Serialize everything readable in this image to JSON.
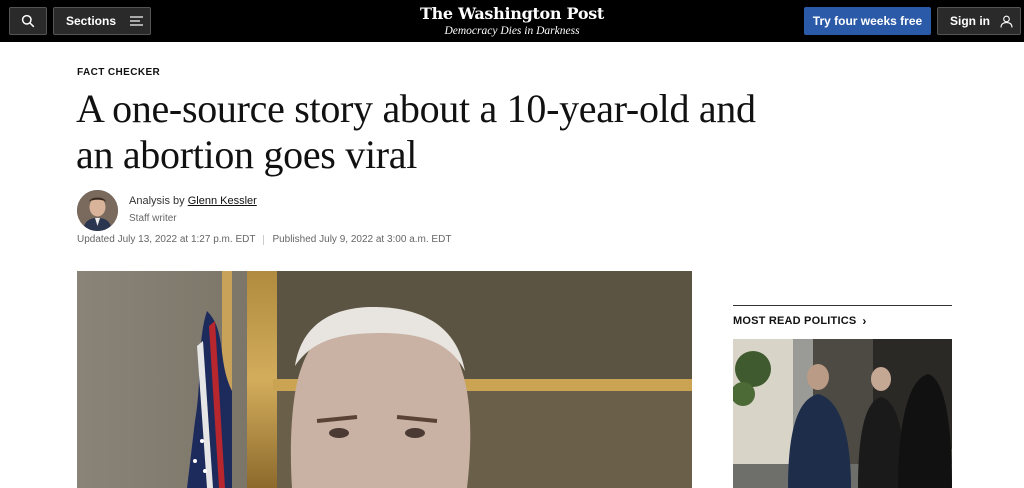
{
  "header": {
    "sections_label": "Sections",
    "logo_name": "The Washington Post",
    "logo_tagline": "Democracy Dies in Darkness",
    "subscribe_label": "Try four weeks free",
    "signin_label": "Sign in"
  },
  "article": {
    "kicker": "FACT CHECKER",
    "headline": "A one-source story about a 10-year-old and an abortion goes viral",
    "byline_prefix": "Analysis by",
    "author": "Glenn Kessler",
    "role": "Staff writer",
    "updated": "Updated July 13, 2022 at 1:27 p.m. EDT",
    "published": "Published July 9, 2022 at 3:00 a.m. EDT"
  },
  "sidebar": {
    "title": "MOST READ POLITICS"
  },
  "colors": {
    "topbar": "#000000",
    "subscribe": "#2b5aa8"
  }
}
